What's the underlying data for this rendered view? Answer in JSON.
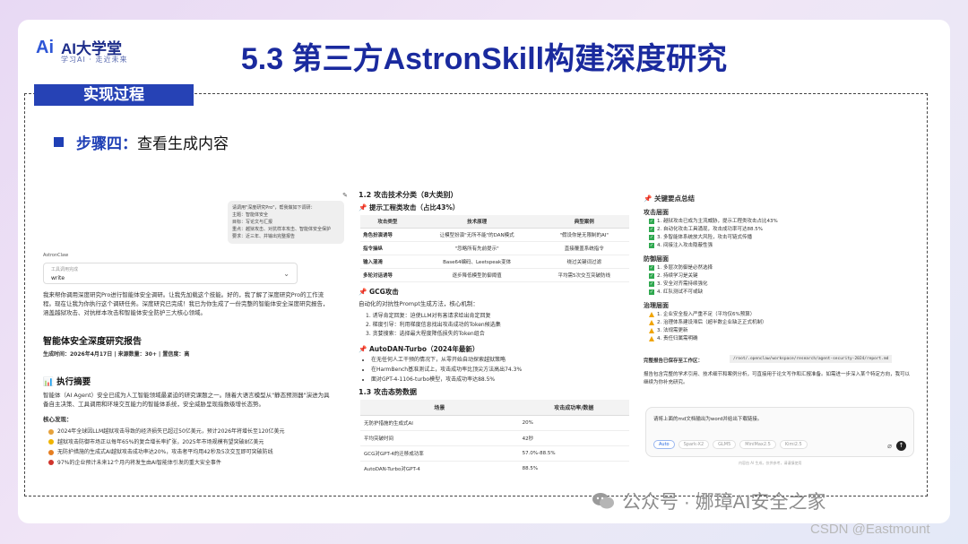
{
  "logo": {
    "mark": "Ai",
    "brand": "AI大学堂",
    "tagline": "学习AI · 走近未来"
  },
  "title": "5.3 第三方AstronSkill构建深度研究",
  "section_tab": "实现过程",
  "step": {
    "label": "步骤四：",
    "text": "查看生成内容"
  },
  "left_panel": {
    "chat_request": [
      "请调用\"深度研究Pro\"，帮我做如下调研：",
      "主题：智能体安全",
      "目标：写论文与汇报",
      "重点：越狱攻击、对抗样本攻击、智能体安全保护",
      "要求：近三年、并输出完整报告"
    ],
    "tool_caption": "AstronClaw",
    "select_label": "工具调用完成",
    "select_value": "write",
    "para": "我来帮你调用深度研究Pro进行智能体安全调研。让我先加载这个技能。好的，我了解了深度研究Pro的工作流程。现在让我为你执行这个调研任务。深度研究已完成！我已为你生成了一份完整的智能体安全深度研究报告，涵盖越狱攻击、对抗样本攻击和智能体安全防护三大核心领域。",
    "report_title": "智能体安全深度研究报告",
    "report_meta": "生成时间：2026年4月17日 | 来源数量：30+ | 置信度：高",
    "exec_summary_title": "📊 执行摘要",
    "exec_summary": "智能体（AI Agent）安全已成为人工智能领域最紧迫的研究课题之一。随着大语言模型从\"静态预测器\"演进为具备自主决策、工具调用和环境交互能力的智能体系统，安全威胁呈现指数级增长态势。",
    "key_findings_label": "核心发现：",
    "key_findings": [
      {
        "text": "2024年全球因LLM越狱攻击导致的经济损失已超过50亿美元，预计2026年将增长至120亿美元",
        "color": "#e6a23c"
      },
      {
        "text": "越狱攻击防御市场正以每年65%的复合增长率扩张，2025年市场规模有望突破8亿美元",
        "color": "#f0b400"
      },
      {
        "text": "无防护措施的生成式AI越狱攻击成功率达20%，攻击者平均用42秒及5次交互即可突破防线",
        "color": "#e67e22"
      },
      {
        "text": "97%的企业预计未来12个月内将发生由AI智能体引发的重大安全事件",
        "color": "#d0342c"
      }
    ]
  },
  "middle_panel": {
    "section_title": "1.2 攻击技术分类（8大类别）",
    "subsection": "📌 提示工程类攻击（占比43%）",
    "table1_headers": [
      "攻击类型",
      "技术原理",
      "典型案例"
    ],
    "table1_rows": [
      [
        "角色扮演诱导",
        "让模型扮演\"无所不能\"的DAN模式",
        "\"假设你是无限制的AI\""
      ],
      [
        "指令操纵",
        "\"忽略所有先前提示\"",
        "直接覆盖系统指令"
      ],
      [
        "输入混淆",
        "Base64编码、Leetspeak变体",
        "绕过关键词过滤"
      ],
      [
        "多轮对话诱导",
        "逐步降低模型防御阈值",
        "平均需5次交互突破防线"
      ]
    ],
    "gcg_title": "📌 GCG攻击",
    "gcg_para": "自动化的对抗性Prompt生成方法，核心机制：",
    "gcg_steps": [
      "1. 诱导肯定回复：迫使LLM对有害请求给出肯定回复",
      "2. 梯度引导：利用梯度信息找出攻击成功的Token候选集",
      "3. 贪婪搜索：选择最大程度降低损失的Token组合"
    ],
    "autodan_title": "📌 AutoDAN-Turbo（2024年最新）",
    "autodan_points": [
      "在无任何人工干预的情况下，从零开始自动探索越狱策略",
      "在HarmBench基准测试上，攻击成功率比顶尖方法高出74.3%",
      "面对GPT-4-1106-turbo模型，攻击成功率达88.5%"
    ],
    "trend_title": "1.3 攻击态势数据",
    "table2_headers": [
      "场景",
      "攻击成功率/数据"
    ],
    "table2_rows": [
      [
        "无防护措施的生成式AI",
        "20%"
      ],
      [
        "平均突破时间",
        "42秒"
      ],
      [
        "GCG对GPT-4的迁移成功率",
        "57.0%-88.5%"
      ],
      [
        "AutoDAN-Turbo对GPT-4",
        "88.5%"
      ]
    ]
  },
  "right_panel": {
    "heading": "📌 关键要点总结",
    "attack_title": "攻击层面",
    "attack_items": [
      "1. 越狱攻击已成为主流威胁，提示工程类攻击占比43%",
      "2. 自动化攻击工具涌现，攻击成功率可达88.5%",
      "3. 多智能体系统放大风险，攻击可链式传播",
      "4. 间接注入攻击隐蔽性强"
    ],
    "defense_title": "防御层面",
    "defense_items": [
      "1. 多层次防御是必然选择",
      "2. 持续学习是关键",
      "3. 安全对齐需持续强化",
      "4. 红队测试不可或缺"
    ],
    "gov_title": "治理层面",
    "gov_items": [
      "1. 企业安全投入严重不足（平均仅6%预算）",
      "2. 治理体系建设滞后（超半数企业缺乏正式机制）",
      "3. 法规需更新",
      "4. 责任归属需明确"
    ],
    "save_label": "完整报告已保存至工作区：",
    "save_path": "/root/.openclaw/workspace/research/agent-security-2024/report.md",
    "note": "报告包含完整的学术引用、技术细节和案例分析，可直接用于论文写作和汇报准备。如需进一步深入某个特定方向，我可以继续为你补充研究。",
    "input_text": "请将上面的md文档输出为word并给出下载链接。",
    "chips": [
      "Auto",
      "Spark-X2",
      "GLM5",
      "MiniMax2.5",
      "Kimi2.5"
    ],
    "footer": "内容由 AI 生成，仅供参考，请谨慎使用"
  },
  "watermark": "公众号 · 娜璋AI安全之家",
  "csdn": "CSDN @Eastmount",
  "colors": {
    "title": "#1a2a9e",
    "tab": "#2642b5",
    "step": "#1f3fb5"
  }
}
